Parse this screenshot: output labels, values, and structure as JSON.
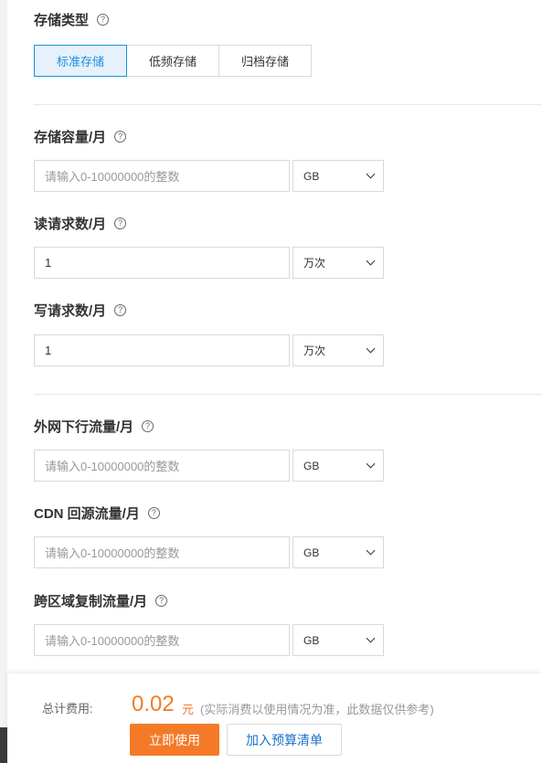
{
  "storage_type": {
    "title": "存储类型",
    "options": [
      "标准存储",
      "低频存储",
      "归档存储"
    ],
    "selected": "标准存储"
  },
  "fields": [
    {
      "label": "存储容量/月",
      "input_value": "",
      "placeholder": "请输入0-10000000的整数",
      "unit": "GB"
    },
    {
      "label": "读请求数/月",
      "input_value": "1",
      "placeholder": "",
      "unit": "万次"
    },
    {
      "label": "写请求数/月",
      "input_value": "1",
      "placeholder": "",
      "unit": "万次"
    },
    {
      "label": "外网下行流量/月",
      "input_value": "",
      "placeholder": "请输入0-10000000的整数",
      "unit": "GB"
    },
    {
      "label": "CDN 回源流量/月",
      "input_value": "",
      "placeholder": "请输入0-10000000的整数",
      "unit": "GB"
    },
    {
      "label": "跨区域复制流量/月",
      "input_value": "",
      "placeholder": "请输入0-10000000的整数",
      "unit": "GB"
    }
  ],
  "help_glyph": "?",
  "footer": {
    "total_label": "总计费用:",
    "total_amount": "0.02",
    "total_unit": "元",
    "total_note": "(实际消费以使用情况为准，此数据仅供参考)",
    "primary_button": "立即使用",
    "secondary_button": "加入预算清单"
  },
  "colors": {
    "accent_blue": "#1a8fe0",
    "accent_orange": "#f47a28"
  }
}
